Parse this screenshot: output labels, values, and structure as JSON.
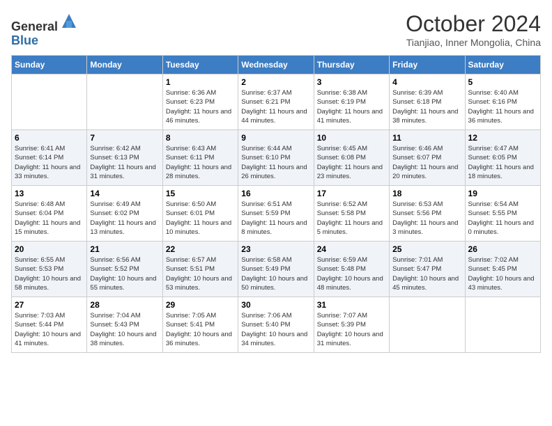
{
  "header": {
    "logo_general": "General",
    "logo_blue": "Blue",
    "month_title": "October 2024",
    "location": "Tianjiao, Inner Mongolia, China"
  },
  "weekdays": [
    "Sunday",
    "Monday",
    "Tuesday",
    "Wednesday",
    "Thursday",
    "Friday",
    "Saturday"
  ],
  "weeks": [
    [
      {
        "day": "",
        "sunrise": "",
        "sunset": "",
        "daylight": ""
      },
      {
        "day": "",
        "sunrise": "",
        "sunset": "",
        "daylight": ""
      },
      {
        "day": "1",
        "sunrise": "Sunrise: 6:36 AM",
        "sunset": "Sunset: 6:23 PM",
        "daylight": "Daylight: 11 hours and 46 minutes."
      },
      {
        "day": "2",
        "sunrise": "Sunrise: 6:37 AM",
        "sunset": "Sunset: 6:21 PM",
        "daylight": "Daylight: 11 hours and 44 minutes."
      },
      {
        "day": "3",
        "sunrise": "Sunrise: 6:38 AM",
        "sunset": "Sunset: 6:19 PM",
        "daylight": "Daylight: 11 hours and 41 minutes."
      },
      {
        "day": "4",
        "sunrise": "Sunrise: 6:39 AM",
        "sunset": "Sunset: 6:18 PM",
        "daylight": "Daylight: 11 hours and 38 minutes."
      },
      {
        "day": "5",
        "sunrise": "Sunrise: 6:40 AM",
        "sunset": "Sunset: 6:16 PM",
        "daylight": "Daylight: 11 hours and 36 minutes."
      }
    ],
    [
      {
        "day": "6",
        "sunrise": "Sunrise: 6:41 AM",
        "sunset": "Sunset: 6:14 PM",
        "daylight": "Daylight: 11 hours and 33 minutes."
      },
      {
        "day": "7",
        "sunrise": "Sunrise: 6:42 AM",
        "sunset": "Sunset: 6:13 PM",
        "daylight": "Daylight: 11 hours and 31 minutes."
      },
      {
        "day": "8",
        "sunrise": "Sunrise: 6:43 AM",
        "sunset": "Sunset: 6:11 PM",
        "daylight": "Daylight: 11 hours and 28 minutes."
      },
      {
        "day": "9",
        "sunrise": "Sunrise: 6:44 AM",
        "sunset": "Sunset: 6:10 PM",
        "daylight": "Daylight: 11 hours and 26 minutes."
      },
      {
        "day": "10",
        "sunrise": "Sunrise: 6:45 AM",
        "sunset": "Sunset: 6:08 PM",
        "daylight": "Daylight: 11 hours and 23 minutes."
      },
      {
        "day": "11",
        "sunrise": "Sunrise: 6:46 AM",
        "sunset": "Sunset: 6:07 PM",
        "daylight": "Daylight: 11 hours and 20 minutes."
      },
      {
        "day": "12",
        "sunrise": "Sunrise: 6:47 AM",
        "sunset": "Sunset: 6:05 PM",
        "daylight": "Daylight: 11 hours and 18 minutes."
      }
    ],
    [
      {
        "day": "13",
        "sunrise": "Sunrise: 6:48 AM",
        "sunset": "Sunset: 6:04 PM",
        "daylight": "Daylight: 11 hours and 15 minutes."
      },
      {
        "day": "14",
        "sunrise": "Sunrise: 6:49 AM",
        "sunset": "Sunset: 6:02 PM",
        "daylight": "Daylight: 11 hours and 13 minutes."
      },
      {
        "day": "15",
        "sunrise": "Sunrise: 6:50 AM",
        "sunset": "Sunset: 6:01 PM",
        "daylight": "Daylight: 11 hours and 10 minutes."
      },
      {
        "day": "16",
        "sunrise": "Sunrise: 6:51 AM",
        "sunset": "Sunset: 5:59 PM",
        "daylight": "Daylight: 11 hours and 8 minutes."
      },
      {
        "day": "17",
        "sunrise": "Sunrise: 6:52 AM",
        "sunset": "Sunset: 5:58 PM",
        "daylight": "Daylight: 11 hours and 5 minutes."
      },
      {
        "day": "18",
        "sunrise": "Sunrise: 6:53 AM",
        "sunset": "Sunset: 5:56 PM",
        "daylight": "Daylight: 11 hours and 3 minutes."
      },
      {
        "day": "19",
        "sunrise": "Sunrise: 6:54 AM",
        "sunset": "Sunset: 5:55 PM",
        "daylight": "Daylight: 11 hours and 0 minutes."
      }
    ],
    [
      {
        "day": "20",
        "sunrise": "Sunrise: 6:55 AM",
        "sunset": "Sunset: 5:53 PM",
        "daylight": "Daylight: 10 hours and 58 minutes."
      },
      {
        "day": "21",
        "sunrise": "Sunrise: 6:56 AM",
        "sunset": "Sunset: 5:52 PM",
        "daylight": "Daylight: 10 hours and 55 minutes."
      },
      {
        "day": "22",
        "sunrise": "Sunrise: 6:57 AM",
        "sunset": "Sunset: 5:51 PM",
        "daylight": "Daylight: 10 hours and 53 minutes."
      },
      {
        "day": "23",
        "sunrise": "Sunrise: 6:58 AM",
        "sunset": "Sunset: 5:49 PM",
        "daylight": "Daylight: 10 hours and 50 minutes."
      },
      {
        "day": "24",
        "sunrise": "Sunrise: 6:59 AM",
        "sunset": "Sunset: 5:48 PM",
        "daylight": "Daylight: 10 hours and 48 minutes."
      },
      {
        "day": "25",
        "sunrise": "Sunrise: 7:01 AM",
        "sunset": "Sunset: 5:47 PM",
        "daylight": "Daylight: 10 hours and 45 minutes."
      },
      {
        "day": "26",
        "sunrise": "Sunrise: 7:02 AM",
        "sunset": "Sunset: 5:45 PM",
        "daylight": "Daylight: 10 hours and 43 minutes."
      }
    ],
    [
      {
        "day": "27",
        "sunrise": "Sunrise: 7:03 AM",
        "sunset": "Sunset: 5:44 PM",
        "daylight": "Daylight: 10 hours and 41 minutes."
      },
      {
        "day": "28",
        "sunrise": "Sunrise: 7:04 AM",
        "sunset": "Sunset: 5:43 PM",
        "daylight": "Daylight: 10 hours and 38 minutes."
      },
      {
        "day": "29",
        "sunrise": "Sunrise: 7:05 AM",
        "sunset": "Sunset: 5:41 PM",
        "daylight": "Daylight: 10 hours and 36 minutes."
      },
      {
        "day": "30",
        "sunrise": "Sunrise: 7:06 AM",
        "sunset": "Sunset: 5:40 PM",
        "daylight": "Daylight: 10 hours and 34 minutes."
      },
      {
        "day": "31",
        "sunrise": "Sunrise: 7:07 AM",
        "sunset": "Sunset: 5:39 PM",
        "daylight": "Daylight: 10 hours and 31 minutes."
      },
      {
        "day": "",
        "sunrise": "",
        "sunset": "",
        "daylight": ""
      },
      {
        "day": "",
        "sunrise": "",
        "sunset": "",
        "daylight": ""
      }
    ]
  ]
}
